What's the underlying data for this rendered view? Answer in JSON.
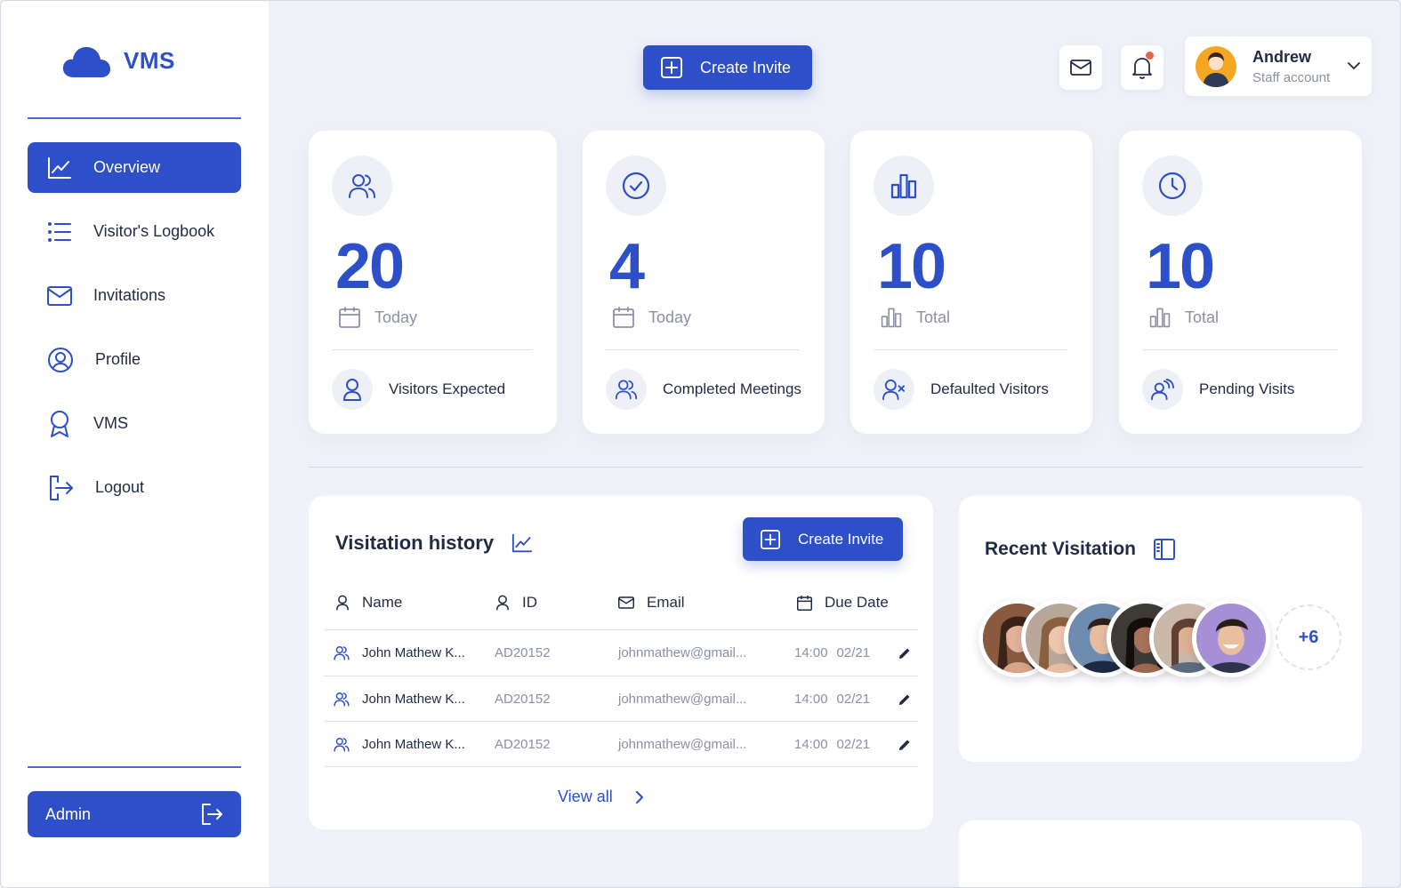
{
  "app": {
    "name": "VMS"
  },
  "sidebar": {
    "items": [
      {
        "label": "Overview",
        "icon": "chart-line-icon",
        "active": true
      },
      {
        "label": "Visitor's Logbook",
        "icon": "list-icon"
      },
      {
        "label": "Invitations",
        "icon": "mail-icon"
      },
      {
        "label": "Profile",
        "icon": "user-circle-icon"
      },
      {
        "label": "VMS",
        "icon": "award-icon"
      },
      {
        "label": "Logout",
        "icon": "logout-icon"
      }
    ],
    "admin_label": "Admin"
  },
  "topbar": {
    "create_label": "Create Invite",
    "user": {
      "name": "Andrew",
      "role": "Staff account"
    }
  },
  "stats": [
    {
      "value": "20",
      "period": "Today",
      "label": "Visitors Expected"
    },
    {
      "value": "4",
      "period": "Today",
      "label": "Completed Meetings"
    },
    {
      "value": "10",
      "period": "Total",
      "label": "Defaulted Visitors"
    },
    {
      "value": "10",
      "period": "Total",
      "label": "Pending Visits"
    }
  ],
  "history": {
    "title": "Visitation history",
    "create_label": "Create Invite",
    "columns": {
      "name": "Name",
      "id": "ID",
      "email": "Email",
      "due": "Due Date"
    },
    "rows": [
      {
        "name": "John Mathew K...",
        "id": "AD20152",
        "email": "johnmathew@gmail...",
        "time": "14:00",
        "date": "02/21"
      },
      {
        "name": "John Mathew K...",
        "id": "AD20152",
        "email": "johnmathew@gmail...",
        "time": "14:00",
        "date": "02/21"
      },
      {
        "name": "John Mathew K...",
        "id": "AD20152",
        "email": "johnmathew@gmail...",
        "time": "14:00",
        "date": "02/21"
      }
    ],
    "view_all": "View all"
  },
  "recent": {
    "title": "Recent Visitation",
    "more_count": "+6"
  },
  "colors": {
    "accent": "#2d4fc7",
    "notification": "#e2674a",
    "avatar": "#f5a623"
  }
}
